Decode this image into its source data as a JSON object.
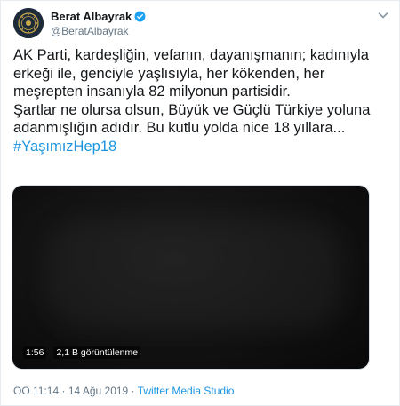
{
  "author": {
    "display_name": "Berat Albayrak",
    "handle": "@BeratAlbayrak",
    "verified": true
  },
  "tweet": {
    "lines": [
      "AK Parti, kardeşliğin, vefanın, dayanışmanın; kadınıyla",
      "erkeği ile, genciyle yaşlısıyla, her kökenden, her",
      "meşrepten insanıyla 82 milyonun partisidir.",
      "Şartlar ne olursa olsun, Büyük ve Güçlü Türkiye yoluna",
      "adanmışlığın adıdır. Bu kutlu yolda nice 18 yıllara..."
    ],
    "hashtag": "#YaşımızHep18"
  },
  "video": {
    "duration": "1:56",
    "views": "2,1 B görüntülenme"
  },
  "footer": {
    "time": "ÖÖ 11:14",
    "separator1": " · ",
    "date": "14 Ağu 2019",
    "separator2": " · ",
    "source": "Twitter Media Studio"
  },
  "colors": {
    "text": "#14171a",
    "secondary": "#657786",
    "link": "#1b95e0",
    "verified": "#1da1f2"
  },
  "icons": {
    "verified": "verified-badge-icon",
    "menu": "chevron-down-icon"
  }
}
